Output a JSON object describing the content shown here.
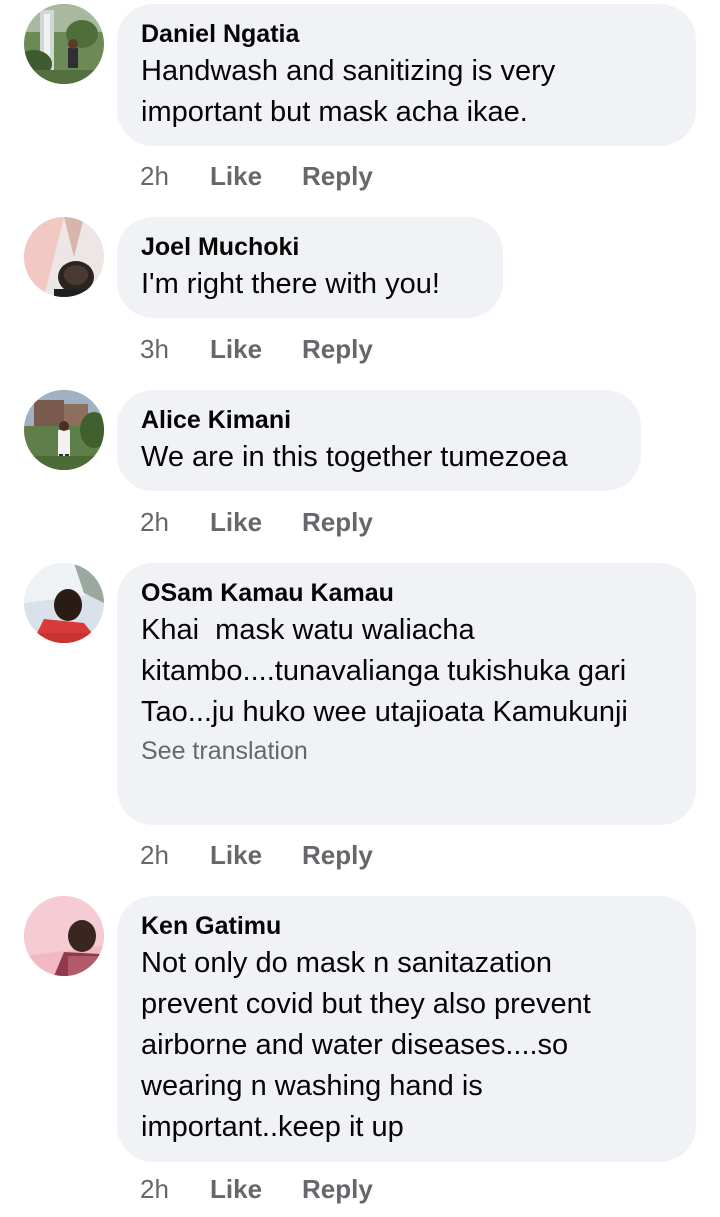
{
  "comments": [
    {
      "author": "Daniel Ngatia",
      "text": "Handwash and sanitizing is very important but mask acha ikae.",
      "time": "2h",
      "like_label": "Like",
      "reply_label": "Reply",
      "avatar_icon": "profile-photo-waterfall"
    },
    {
      "author": "Joel Muchoki",
      "text": "I'm right there with you!",
      "time": "3h",
      "like_label": "Like",
      "reply_label": "Reply",
      "avatar_icon": "profile-photo-selfie"
    },
    {
      "author": "Alice Kimani",
      "text": "We are in this together tumezoea",
      "time": "2h",
      "like_label": "Like",
      "reply_label": "Reply",
      "avatar_icon": "profile-photo-outdoor"
    },
    {
      "author": "OSam Kamau Kamau",
      "text": "Khai  mask watu waliacha kitambo....tunavalianga tukishuka gari Tao...ju huko wee utajioata Kamukunji",
      "see_translation": "See translation",
      "time": "2h",
      "like_label": "Like",
      "reply_label": "Reply",
      "avatar_icon": "profile-photo-sky"
    },
    {
      "author": "Ken Gatimu",
      "text": "Not only do mask n sanitazation prevent covid but they also prevent airborne and water diseases....so wearing n washing hand is important..keep it up",
      "time": "2h",
      "like_label": "Like",
      "reply_label": "Reply",
      "avatar_icon": "profile-photo-pink"
    }
  ],
  "colors": {
    "bubble_background": "#f0f2f5",
    "text": "#050505",
    "secondary_text": "#65676b"
  }
}
